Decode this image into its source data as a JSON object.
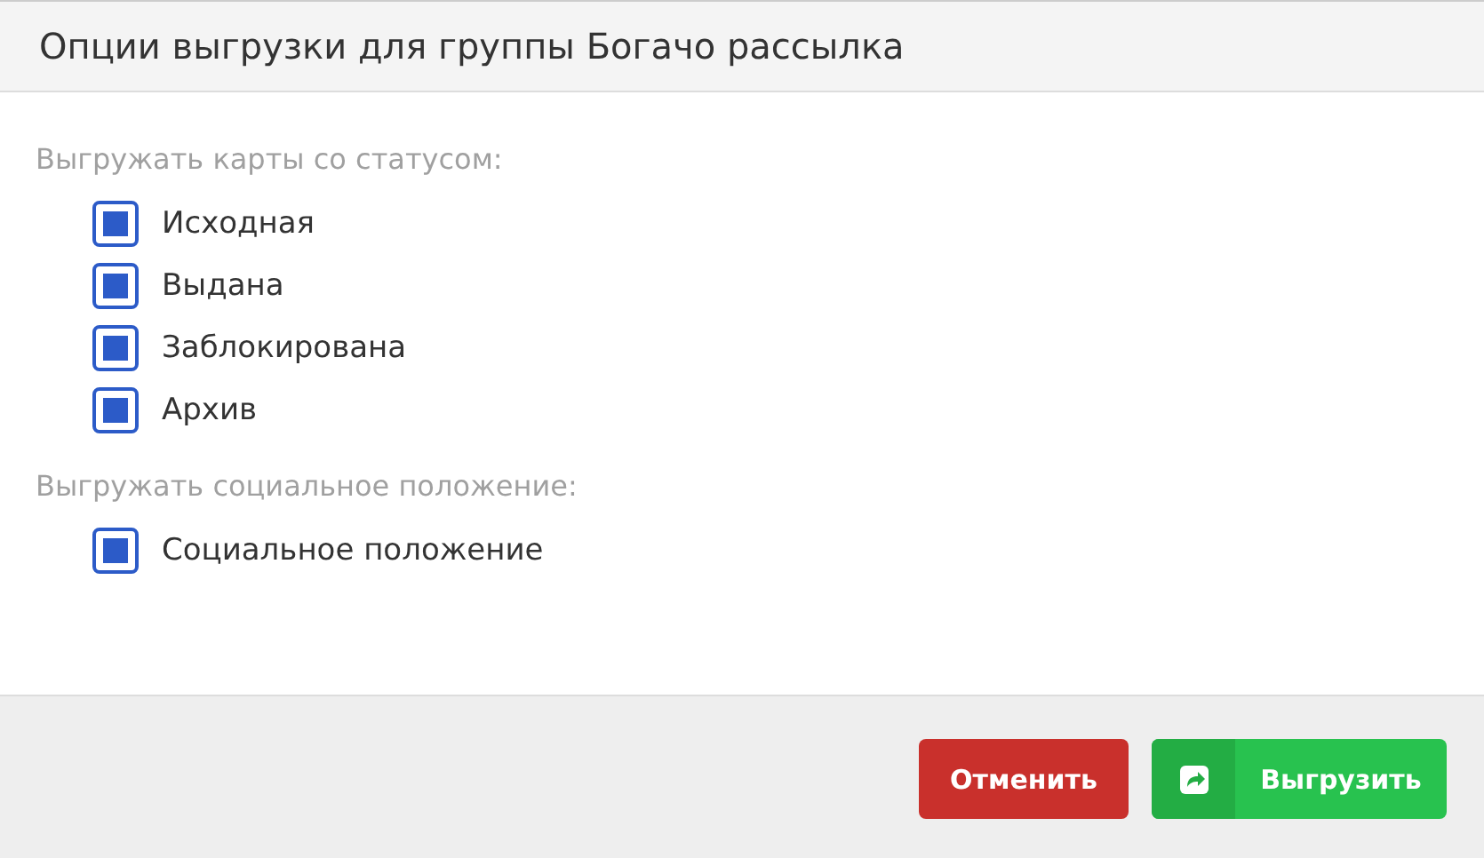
{
  "dialog": {
    "title": "Опции выгрузки для группы Богачо рассылка"
  },
  "sections": [
    {
      "label": "Выгружать карты со статусом:",
      "options": [
        {
          "label": "Исходная",
          "checked": true
        },
        {
          "label": "Выдана",
          "checked": true
        },
        {
          "label": "Заблокирована",
          "checked": true
        },
        {
          "label": "Архив",
          "checked": true
        }
      ]
    },
    {
      "label": "Выгружать социальное положение:",
      "options": [
        {
          "label": "Социальное положение",
          "checked": true
        }
      ]
    }
  ],
  "buttons": [
    {
      "kind": "cancel",
      "label": "Отменить"
    },
    {
      "kind": "export",
      "label": "Выгрузить"
    }
  ]
}
